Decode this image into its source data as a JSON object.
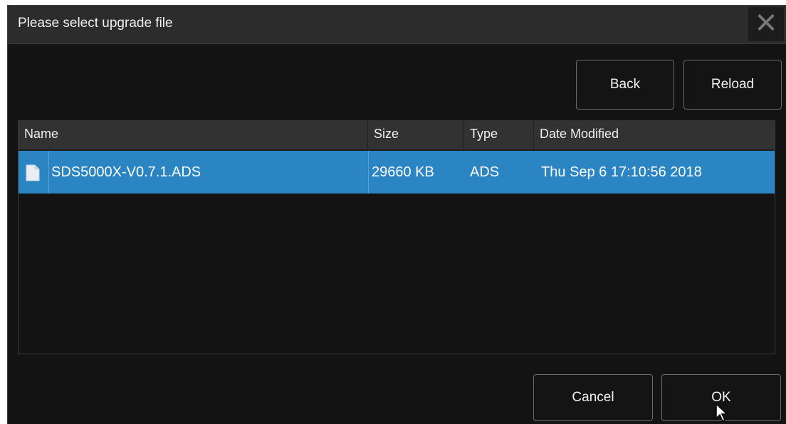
{
  "dialog": {
    "title": "Please select upgrade file",
    "close_icon": "close-icon"
  },
  "toolbar": {
    "back_label": "Back",
    "reload_label": "Reload"
  },
  "table": {
    "columns": [
      "Name",
      "Size",
      "Type",
      "Date Modified"
    ],
    "rows": [
      {
        "icon": "file-icon",
        "name": "SDS5000X-V0.7.1.ADS",
        "size": "29660 KB",
        "type": "ADS",
        "date": "Thu Sep 6 17:10:56 2018",
        "selected": true
      }
    ]
  },
  "footer": {
    "cancel_label": "Cancel",
    "ok_label": "OK"
  },
  "colors": {
    "selection": "#2b85c2",
    "background": "#131313",
    "header": "#323232"
  }
}
